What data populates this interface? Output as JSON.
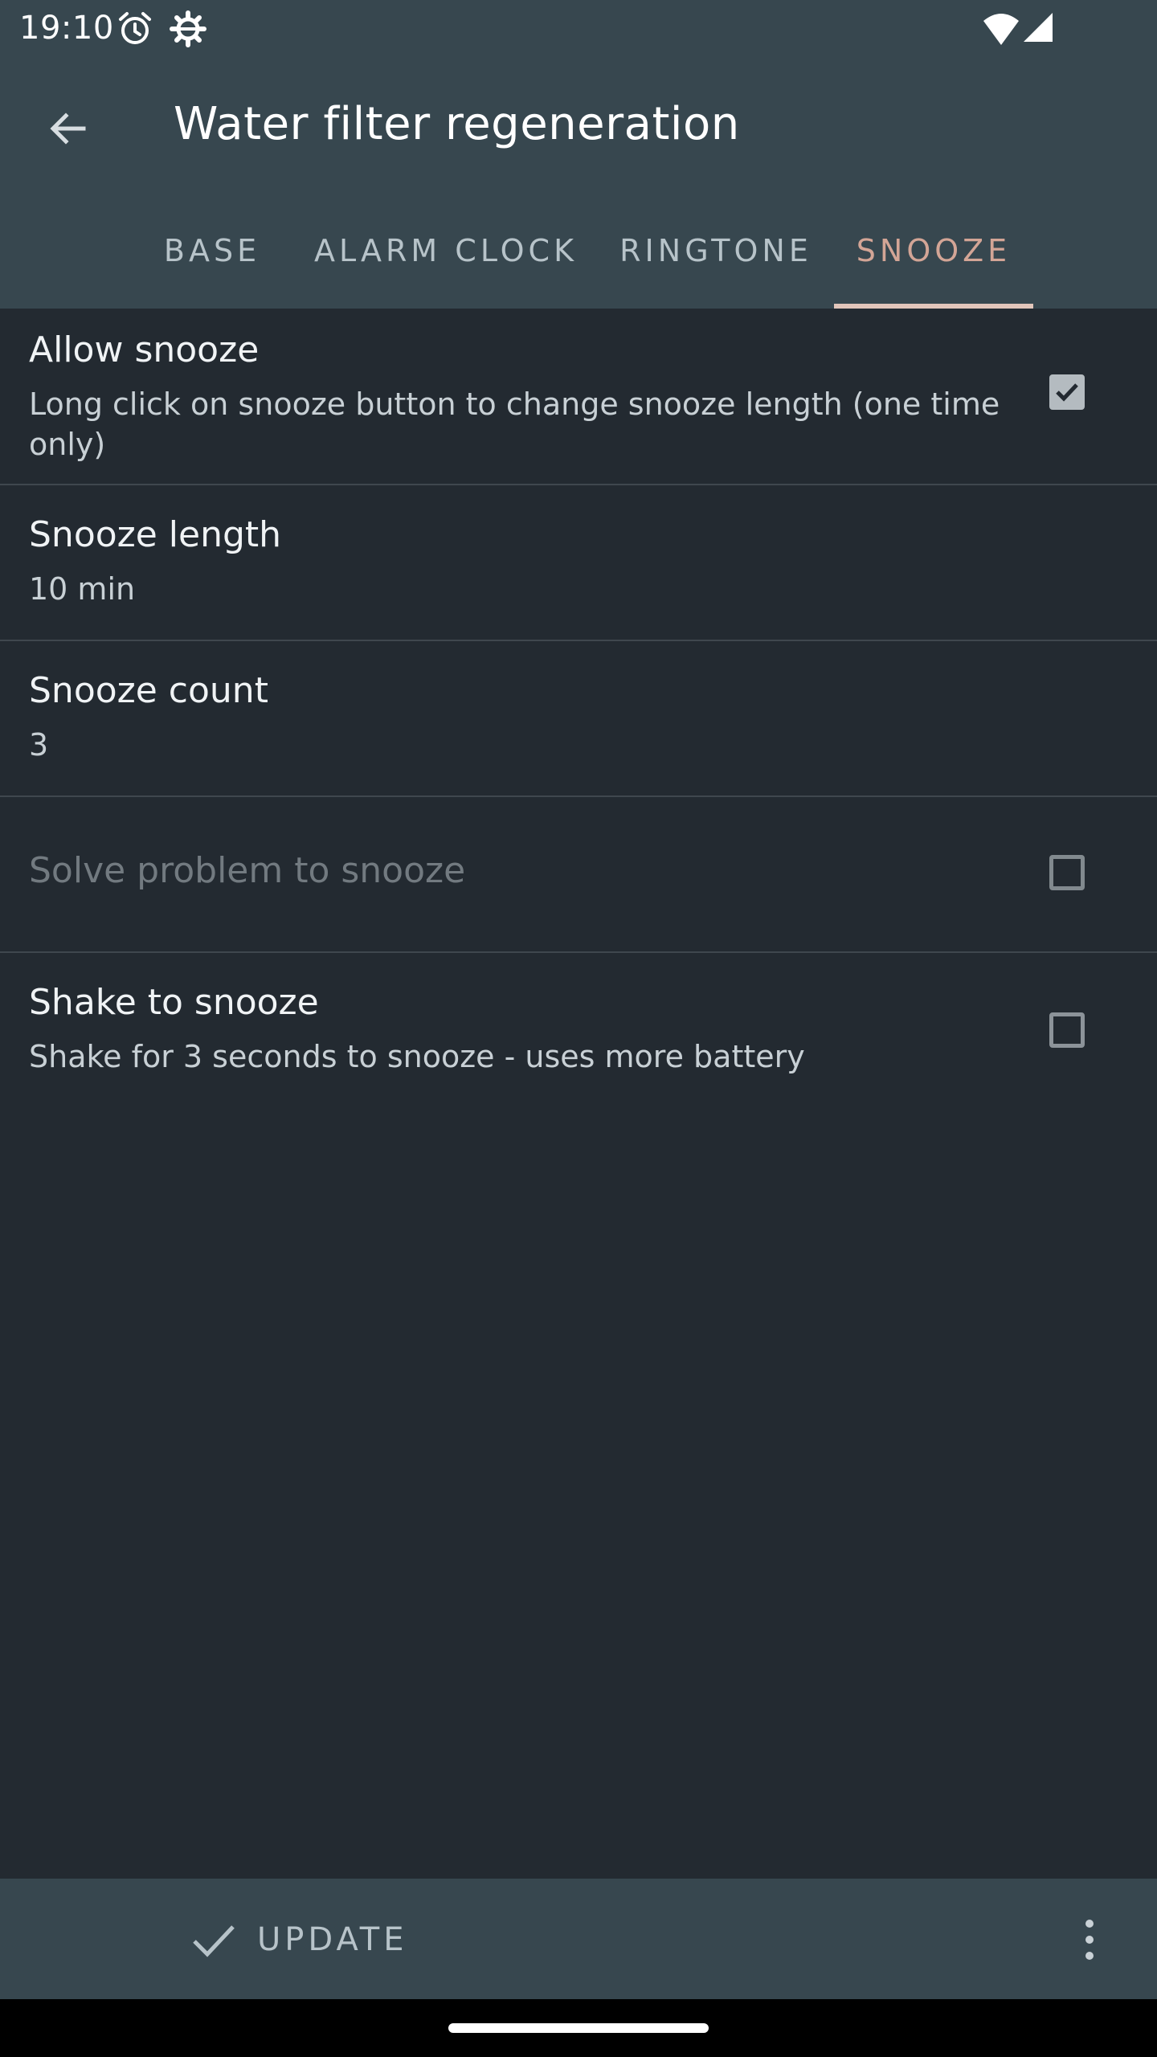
{
  "status_bar": {
    "time": "19:10",
    "icons": [
      "alarm-icon",
      "settings-gear-icon",
      "wifi-icon",
      "signal-icon"
    ]
  },
  "toolbar": {
    "title": "Water filter regeneration",
    "back_icon": "arrow-back-icon"
  },
  "tabs": [
    {
      "label": "BASE",
      "active": false
    },
    {
      "label": "ALARM CLOCK",
      "active": false
    },
    {
      "label": "RINGTONE",
      "active": false
    },
    {
      "label": "SNOOZE",
      "active": true
    }
  ],
  "preferences": [
    {
      "title": "Allow snooze",
      "summary": "Long click on snooze button to change snooze length (one time only)",
      "checkbox": true,
      "checked": true,
      "enabled": true
    },
    {
      "title": "Snooze length",
      "summary": "10 min",
      "enabled": true
    },
    {
      "title": "Snooze count",
      "summary": "3",
      "enabled": true
    },
    {
      "title": "Solve problem to snooze",
      "checkbox": true,
      "checked": false,
      "enabled": false
    },
    {
      "title": "Shake to snooze",
      "summary": "Shake for 3 seconds to snooze - uses more battery",
      "checkbox": true,
      "checked": false,
      "enabled": true
    }
  ],
  "bottom_bar": {
    "update_label": "UPDATE",
    "update_icon": "check-icon",
    "more_icon": "more-vert-icon"
  },
  "colors": {
    "background": "#232a31",
    "appbar": "#37474f",
    "active_tab": "#d3a596",
    "tab_indicator": "#e2c6bb"
  }
}
